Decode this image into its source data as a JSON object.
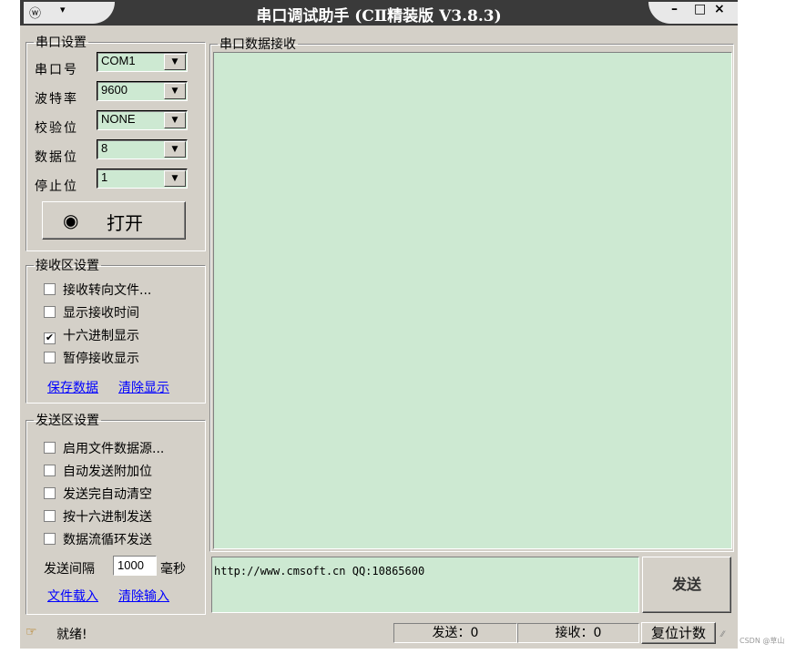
{
  "window": {
    "title": "串口调试助手 (CⅡ精装版 V3.8.3)",
    "sys_icon": "ⓦ",
    "sys_dropdown": "▾",
    "controls": {
      "minimize": "–",
      "maximize": "□",
      "close": "×"
    }
  },
  "serial": {
    "legend": "串口设置",
    "fields": [
      {
        "label": "串口号",
        "value": "COM1"
      },
      {
        "label": "波特率",
        "value": "9600"
      },
      {
        "label": "校验位",
        "value": "NONE"
      },
      {
        "label": "数据位",
        "value": "8"
      },
      {
        "label": "停止位",
        "value": "1"
      }
    ],
    "open_icon": "◉",
    "open_button": "打开"
  },
  "receive_area": {
    "legend": "串口数据接收",
    "content": ""
  },
  "receive_settings": {
    "legend": "接收区设置",
    "options": [
      {
        "label": "接收转向文件...",
        "checked": false
      },
      {
        "label": "显示接收时间",
        "checked": false
      },
      {
        "label": "十六进制显示",
        "checked": true
      },
      {
        "label": "暂停接收显示",
        "checked": false
      }
    ],
    "save_link": "保存数据",
    "clear_link": "清除显示"
  },
  "send_settings": {
    "legend": "发送区设置",
    "options": [
      {
        "label": "启用文件数据源...",
        "checked": false
      },
      {
        "label": "自动发送附加位",
        "checked": false
      },
      {
        "label": "发送完自动清空",
        "checked": false
      },
      {
        "label": "按十六进制发送",
        "checked": false
      },
      {
        "label": "数据流循环发送",
        "checked": false
      }
    ],
    "interval_label": "发送间隔",
    "interval_value": "1000",
    "interval_unit": "毫秒",
    "load_link": "文件载入",
    "clear_link": "清除输入"
  },
  "send_box": {
    "text": "http://www.cmsoft.cn QQ:10865600",
    "send_button": "发送"
  },
  "status": {
    "icon": "☞",
    "ready": "就绪!",
    "sent": "发送：0",
    "received": "接收：0",
    "reset_button": "复位计数"
  },
  "watermark": "CSDN @草山"
}
